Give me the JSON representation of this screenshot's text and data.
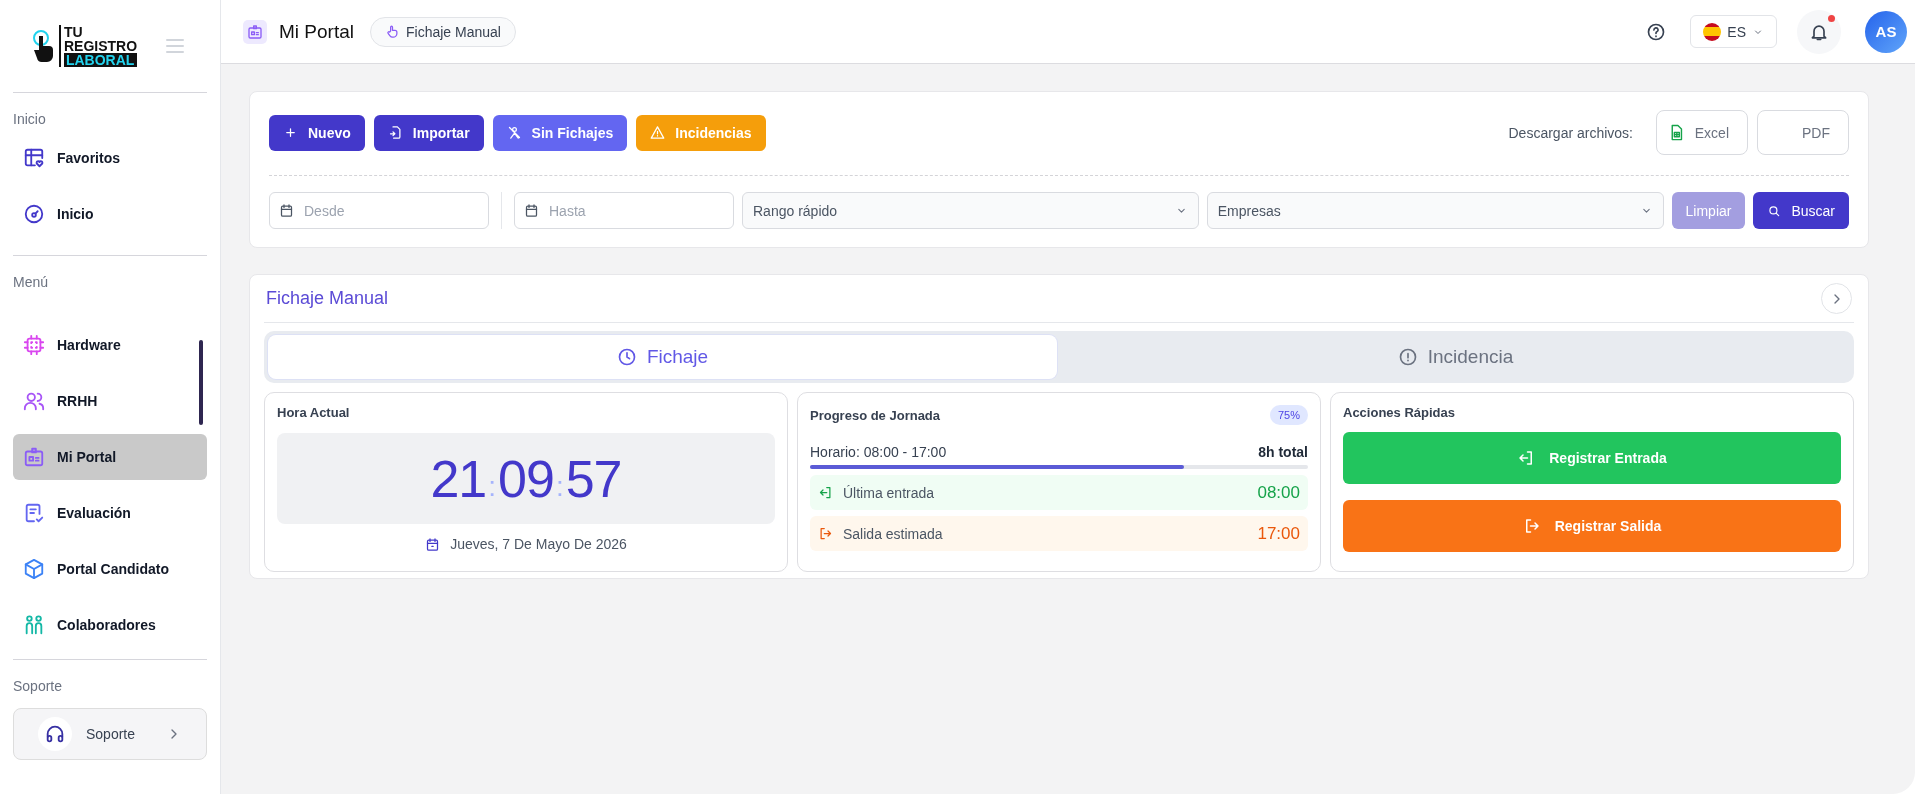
{
  "sidebar": {
    "logo": [
      "TU",
      "REGISTRO",
      "LABORAL"
    ],
    "sections": [
      {
        "title": "Inicio",
        "items": [
          {
            "label": "Favoritos",
            "selected": false
          },
          {
            "label": "Inicio",
            "selected": false
          }
        ]
      },
      {
        "title": "Menú",
        "items": [
          {
            "label": "Hardware",
            "selected": false
          },
          {
            "label": "RRHH",
            "selected": false
          },
          {
            "label": "Mi Portal",
            "selected": true
          },
          {
            "label": "Evaluación",
            "selected": false
          },
          {
            "label": "Portal Candidato",
            "selected": false
          },
          {
            "label": "Colaboradores",
            "selected": false
          }
        ]
      }
    ],
    "support": {
      "title": "Soporte",
      "button": "Soporte"
    }
  },
  "topbar": {
    "title": "Mi Portal",
    "breadcrumb": "Fichaje Manual",
    "language": "ES",
    "notification": true,
    "avatar": "AS"
  },
  "toolbar": {
    "buttons": [
      {
        "label": "Nuevo",
        "kind": "primary"
      },
      {
        "label": "Importar",
        "kind": "primary"
      },
      {
        "label": "Sin Fichajes",
        "kind": "secondary"
      },
      {
        "label": "Incidencias",
        "kind": "warning"
      }
    ],
    "downloads": {
      "label": "Descargar archivos:",
      "buttons": [
        "Excel",
        "PDF"
      ]
    }
  },
  "filters": {
    "dates": [
      {
        "placeholder": "Desde"
      },
      {
        "placeholder": "Hasta"
      }
    ],
    "selects": [
      {
        "value": "Rango rápido"
      },
      {
        "value": "Empresas"
      }
    ],
    "buttons": [
      {
        "label": "Limpiar",
        "disabled": true
      },
      {
        "label": "Buscar",
        "disabled": false
      }
    ]
  },
  "panel": {
    "title": "Fichaje Manual",
    "tabs": [
      {
        "label": "Fichaje",
        "selected": true
      },
      {
        "label": "Incidencia",
        "selected": false
      }
    ],
    "clock": {
      "title": "Hora Actual",
      "parts": [
        "21",
        "09",
        "57"
      ],
      "separator": ":",
      "date": "Jueves, 7 De Mayo De 2026"
    },
    "progress": {
      "title": "Progreso de Jornada",
      "badge": "75%",
      "schedule": "Horario: 08:00 - 17:00",
      "total": "8h total",
      "level": 0.75,
      "rows": [
        {
          "kind": "entry",
          "label": "Última entrada",
          "time": "08:00"
        },
        {
          "kind": "exit",
          "label": "Salida estimada",
          "time": "17:00"
        }
      ]
    },
    "actions": {
      "title": "Acciones Rápidas",
      "buttons": [
        {
          "kind": "entry",
          "label": "Registrar Entrada"
        },
        {
          "kind": "exit",
          "label": "Registrar Salida"
        }
      ]
    }
  }
}
